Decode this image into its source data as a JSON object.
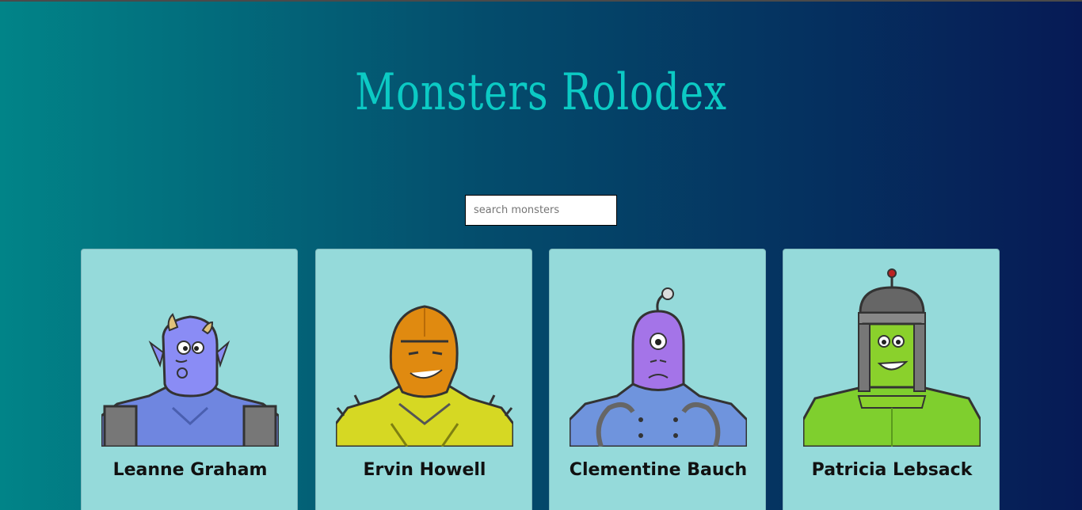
{
  "header": {
    "title": "Monsters Rolodex"
  },
  "search": {
    "placeholder": "search monsters",
    "value": ""
  },
  "monsters": [
    {
      "name": "Leanne Graham",
      "skin": "#8a8cf5",
      "body": "#6f86e0",
      "accent": "#e0c27a"
    },
    {
      "name": "Ervin Howell",
      "skin": "#e08a10",
      "body": "#d6d823",
      "accent": "#3a3a3a"
    },
    {
      "name": "Clementine Bauch",
      "skin": "#a474e8",
      "body": "#6f94dd",
      "accent": "#3a3a3a"
    },
    {
      "name": "Patricia Lebsack",
      "skin": "#8ad12c",
      "body": "#7fcf2e",
      "accent": "#666666"
    }
  ],
  "colors": {
    "background_start": "#018488",
    "background_end": "#061a55",
    "title": "#0ccac4",
    "card": "#95dada"
  }
}
